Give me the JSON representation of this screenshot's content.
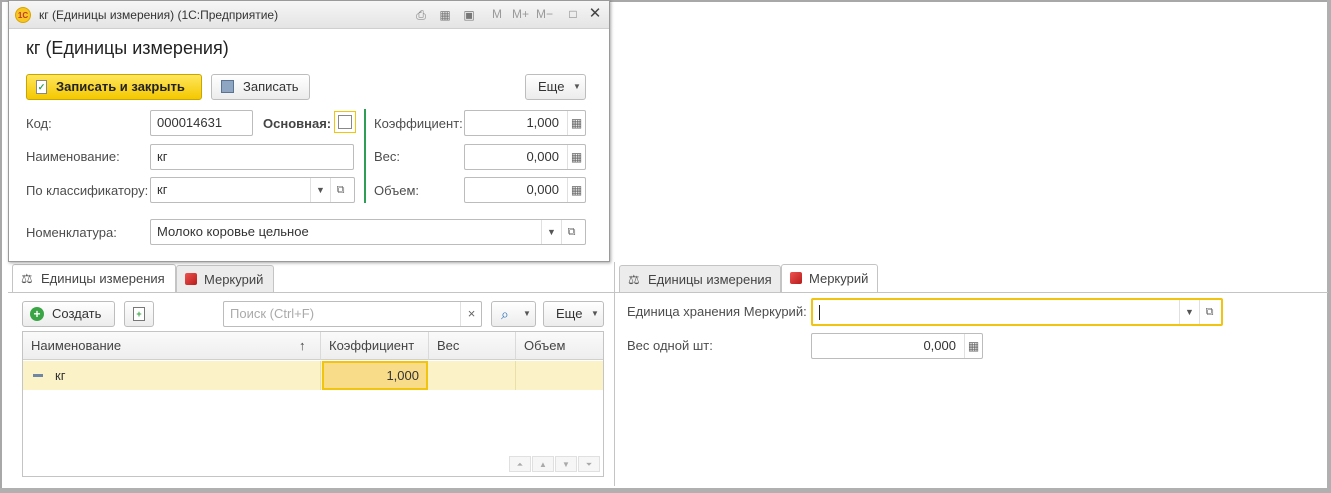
{
  "window": {
    "title": "кг (Единицы измерения)  (1С:Предприятие)",
    "m_buttons": [
      "M",
      "M+",
      "M−"
    ]
  },
  "form": {
    "heading": "кг (Единицы измерения)",
    "save_close_label": "Записать и закрыть",
    "save_label": "Записать",
    "more_label": "Еще",
    "code_label": "Код:",
    "code_value": "000014631",
    "main_label": "Основная:",
    "name_label": "Наименование:",
    "name_value": "кг",
    "classifier_label": "По классификатору:",
    "classifier_value": "кг",
    "coef_label": "Коэффициент:",
    "coef_value": "1,000",
    "weight_label": "Вес:",
    "weight_value": "0,000",
    "volume_label": "Объем:",
    "volume_value": "0,000",
    "nomenclature_label": "Номенклатура:",
    "nomenclature_value": "Молоко коровье цельное"
  },
  "left_panel": {
    "tabs": [
      "Единицы измерения",
      "Меркурий"
    ],
    "create_label": "Создать",
    "search_placeholder": "Поиск (Ctrl+F)",
    "more_label": "Еще",
    "columns": [
      "Наименование",
      "Коэффициент",
      "Вес",
      "Объем"
    ],
    "sort_arrow": "↑",
    "rows": [
      {
        "name": "кг",
        "coef": "1,000",
        "weight": "",
        "volume": ""
      }
    ]
  },
  "right_panel": {
    "tabs": [
      "Единицы измерения",
      "Меркурий"
    ],
    "unit_label": "Единица хранения Меркурий:",
    "unit_value": "",
    "piece_weight_label": "Вес одной шт:",
    "piece_weight_value": "0,000"
  },
  "colors": {
    "accent": "#f4c800",
    "selection": "#fbf2c8",
    "focus_border": "#f1c40f",
    "divider_green": "#2e9e55"
  }
}
